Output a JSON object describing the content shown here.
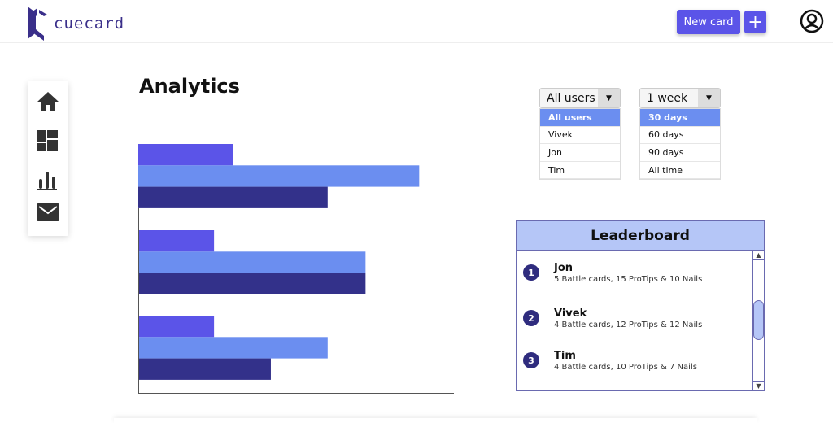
{
  "header": {
    "logo_text": "cuecard",
    "new_card_label": "New card",
    "add_label": "+"
  },
  "sidebar": {
    "items": [
      {
        "icon": "home-icon"
      },
      {
        "icon": "dashboard-icon"
      },
      {
        "icon": "analytics-icon"
      },
      {
        "icon": "mail-icon"
      }
    ]
  },
  "page": {
    "title": "Analytics"
  },
  "filters": {
    "user": {
      "value": "All users",
      "options": [
        "All users",
        "Vivek",
        "Jon",
        "Tim"
      ],
      "highlighted": "All users"
    },
    "period": {
      "value": "1 week",
      "options": [
        "30 days",
        "60 days",
        "90 days",
        "All time"
      ],
      "highlighted": "30 days"
    }
  },
  "leaderboard": {
    "title": "Leaderboard",
    "items": [
      {
        "rank": "1",
        "name": "Jon",
        "detail": "5 Battle cards, 15 ProTips & 10 Nails"
      },
      {
        "rank": "2",
        "name": "Vivek",
        "detail": "4 Battle cards, 12 ProTips & 12 Nails"
      },
      {
        "rank": "3",
        "name": "Tim",
        "detail": "4 Battle cards, 10 ProTips & 7 Nails"
      }
    ]
  },
  "colors": {
    "accent": "#5b54e8",
    "bar_1": "#5b54e8",
    "bar_2": "#6b8ef0",
    "bar_3": "#33318a",
    "leaderboard_header": "#b5c6f7",
    "rank_badge": "#2f2c7e"
  },
  "chart_data": {
    "type": "bar",
    "orientation": "horizontal",
    "xlim": [
      0,
      100
    ],
    "grid": false,
    "groups": [
      [
        30,
        89,
        60
      ],
      [
        24,
        72,
        72
      ],
      [
        24,
        60,
        42
      ]
    ]
  }
}
